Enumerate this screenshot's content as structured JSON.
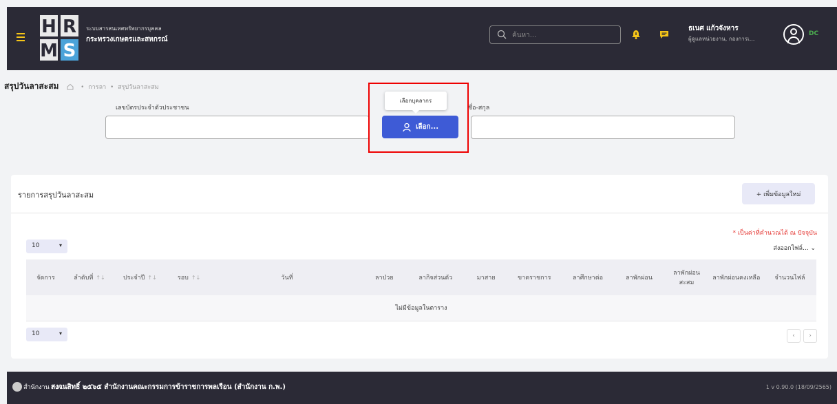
{
  "header": {
    "system_title": "ระบบสารสนเทศทรัพยากรบุคคล",
    "ministry": "กระทรวงเกษตรและสหกรณ์",
    "search_placeholder": "ค้นหา...",
    "user_name": "ธเนศ แก้วจังหาร",
    "user_role": "ผู้ดูแลหน่วยงาน, กองการเ...",
    "user_initials": "DC",
    "logo_letters": [
      "H",
      "R",
      "M",
      "S"
    ]
  },
  "page": {
    "title": "สรุปวันลาสะสม",
    "breadcrumb": [
      "การลา",
      "สรุปวันลาสะสม"
    ]
  },
  "form": {
    "id_label": "เลขบัตรประจำตัวประชาชน",
    "name_label": "ชื่อ-สกุล",
    "id_value": "",
    "name_value": "",
    "select_button": "เลือก...",
    "tooltip": "เลือกบุคลากร"
  },
  "list": {
    "title": "รายการสรุปวันลาสะสม",
    "add_button": "+ เพิ่มข้อมูลใหม่",
    "note": "* เป็นค่าที่คำนวณได้ ณ ปัจจุบัน",
    "export": "ส่งออกไฟล์...",
    "page_size": "10",
    "columns": [
      "จัดการ",
      "ลำดับที่",
      "ประจำปี",
      "รอบ",
      "วันที่",
      "ลาป่วย",
      "ลากิจส่วนตัว",
      "มาสาย",
      "ขาดราชการ",
      "ลาศึกษาต่อ",
      "ลาพักผ่อน",
      "ลาพักผ่อนสะสม",
      "ลาพักผ่อนคงเหลือ",
      "จำนวนไฟล์"
    ],
    "empty_text": "ไม่มีข้อมูลในตาราง"
  },
  "footer": {
    "org": "สำนักงาน ก.พ.",
    "copyright": "สงวนสิทธิ์ ๒๕๖๕ สำนักงานคณะกรรมการข้าราชการพลเรือน (สำนักงาน ก.พ.)",
    "version": "1 v 0.90.0 (18/09/2565)"
  },
  "colors": {
    "topbar": "#2b2a36",
    "accent_blue": "#3e5bd6",
    "menu_yellow": "#f5c518",
    "note_red": "#e53935"
  }
}
